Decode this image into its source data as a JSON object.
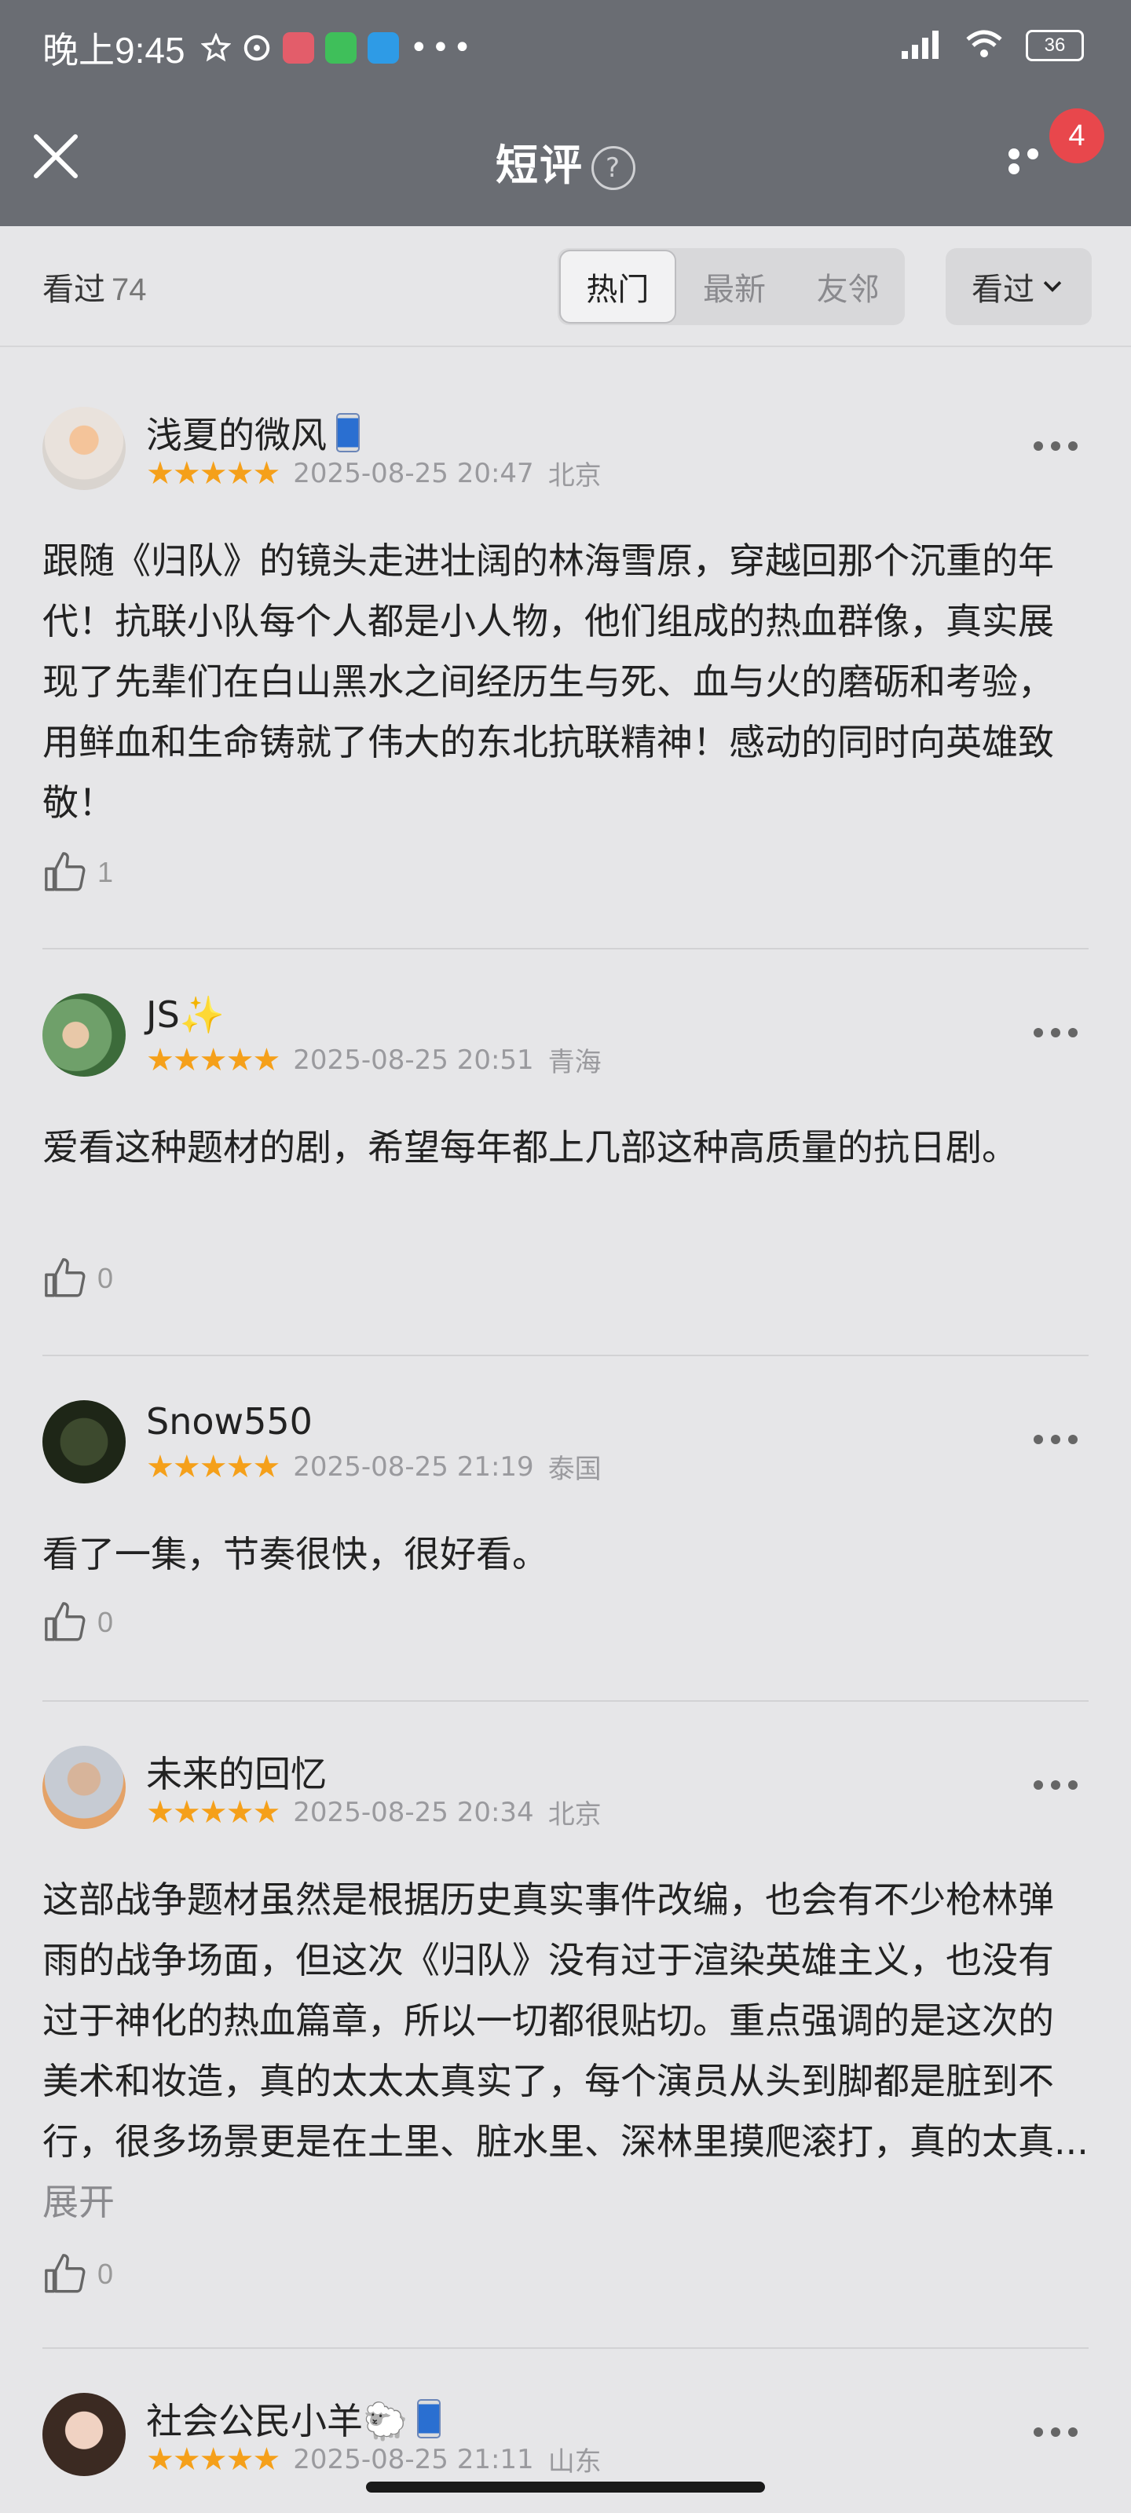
{
  "status_bar": {
    "time": "晚上9:45",
    "battery": "36"
  },
  "header": {
    "title": "短评",
    "help_symbol": "?",
    "notification_badge": "4"
  },
  "filter": {
    "seen_label": "看过",
    "seen_count": "74",
    "tabs": [
      {
        "label": "热门",
        "active": true
      },
      {
        "label": "最新",
        "active": false
      },
      {
        "label": "友邻",
        "active": false
      }
    ],
    "dropdown_label": "看过"
  },
  "comments": [
    {
      "user": "浅夏的微风",
      "stars": "★★★★★",
      "time": "2025-08-25 20:47",
      "location": "北京",
      "text": "跟随《归队》的镜头走进壮阔的林海雪原，穿越回那个沉重的年代！抗联小队每个人都是小人物，他们组成的热血群像，真实展现了先辈们在白山黑水之间经历生与死、血与火的磨砺和考验，用鲜血和生命铸就了伟大的东北抗联精神！感动的同时向英雄致敬！",
      "likes": "1"
    },
    {
      "user": "JS✨",
      "stars": "★★★★★",
      "time": "2025-08-25 20:51",
      "location": "青海",
      "text": "爱看这种题材的剧，希望每年都上几部这种高质量的抗日剧。",
      "likes": "0"
    },
    {
      "user": "Snow550",
      "stars": "★★★★★",
      "time": "2025-08-25 21:19",
      "location": "泰国",
      "text": "看了一集，节奏很快，很好看。",
      "likes": "0"
    },
    {
      "user": "未来的回忆",
      "stars": "★★★★★",
      "time": "2025-08-25 20:34",
      "location": "北京",
      "text": "这部战争题材虽然是根据历史真实事件改编，也会有不少枪林弹雨的战争场面，但这次《归队》没有过于渲染英雄主义，也没有过于神化的热血篇章，所以一切都很贴切。重点强调的是这次的美术和妆造，真的太太太真实了，每个演员从头到脚都是脏到不行，很多场景更是在土里、脏水里、深林里摸爬滚打，真的太真...",
      "expand": "展开",
      "likes": "0"
    },
    {
      "user": "社会公民小羊🐑",
      "stars": "★★★★★",
      "time": "2025-08-25 21:11",
      "location": "山东"
    }
  ]
}
